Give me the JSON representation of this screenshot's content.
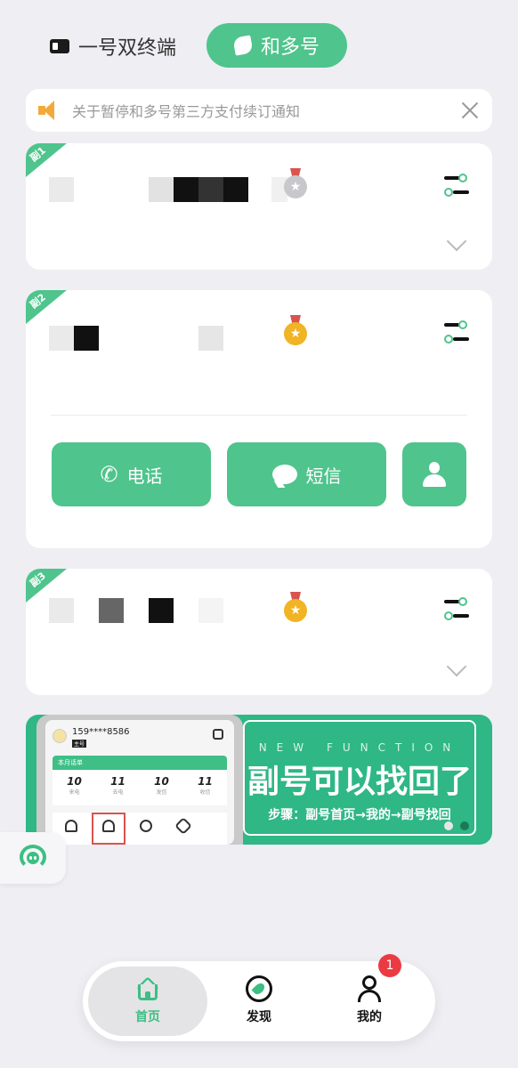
{
  "tabs": {
    "single_label": "一号双终端",
    "multi_label": "和多号"
  },
  "notice": {
    "text": "关于暂停和多号第三方支付续订通知"
  },
  "cards": [
    {
      "corner_label": "副1",
      "medal": "silver"
    },
    {
      "corner_label": "副2",
      "medal": "gold"
    },
    {
      "corner_label": "副3",
      "medal": "gold"
    }
  ],
  "actions": {
    "call_label": "电话",
    "sms_label": "短信"
  },
  "banner": {
    "phone_number": "159****8586",
    "phone_tag": "主号",
    "bill_title": "本月话单",
    "stats": [
      {
        "value": "10",
        "label": "来电"
      },
      {
        "value": "11",
        "label": "去电"
      },
      {
        "value": "10",
        "label": "发信"
      },
      {
        "value": "11",
        "label": "收信"
      }
    ],
    "small_text": "NEW FUNCTION",
    "headline": "副号可以找回了",
    "steps": "步骤：副号首页→我的→副号找回"
  },
  "nav": {
    "home_label": "首页",
    "discover_label": "发现",
    "me_label": "我的",
    "badge_count": "1"
  },
  "colors": {
    "accent": "#4fc48d",
    "badge": "#ea3b43",
    "notice_icon": "#f2a93b"
  }
}
